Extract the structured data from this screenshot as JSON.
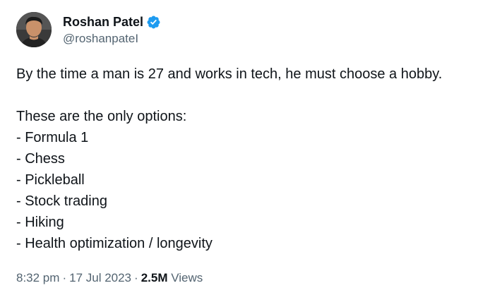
{
  "author": {
    "name": "Roshan Patel",
    "handle": "@roshanpateI",
    "verified_icon": "verified-badge-icon",
    "verified_color": "#1d9bf0"
  },
  "tweet": {
    "intro": "By the time a man is 27 and works in tech, he must choose a hobby.",
    "options_header": "These are the only options:",
    "options": [
      "- Formula 1",
      "- Chess",
      "- Pickleball",
      "- Stock trading",
      "- Hiking",
      "- Health optimization / longevity"
    ]
  },
  "meta": {
    "time": "8:32 pm",
    "date": "17 Jul 2023",
    "separator": "·",
    "views_count": "2.5M",
    "views_label": "Views"
  },
  "colors": {
    "text_primary": "#0f1419",
    "text_secondary": "#536471",
    "accent": "#1d9bf0"
  }
}
